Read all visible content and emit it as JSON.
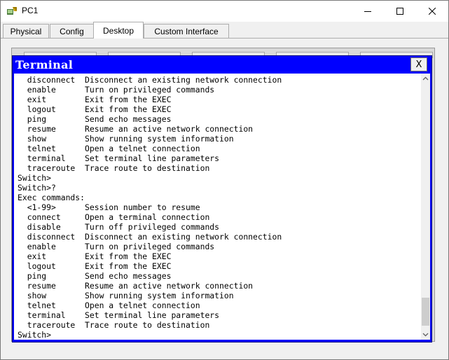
{
  "window": {
    "title": "PC1"
  },
  "tabs": [
    {
      "label": "Physical"
    },
    {
      "label": "Config"
    },
    {
      "label": "Desktop"
    },
    {
      "label": "Custom Interface"
    }
  ],
  "active_tab": "Desktop",
  "terminal": {
    "title": "Terminal",
    "close_label": "X",
    "lines": [
      "  disconnect  Disconnect an existing network connection",
      "  enable      Turn on privileged commands",
      "  exit        Exit from the EXEC",
      "  logout      Exit from the EXEC",
      "  ping        Send echo messages",
      "  resume      Resume an active network connection",
      "  show        Show running system information",
      "  telnet      Open a telnet connection",
      "  terminal    Set terminal line parameters",
      "  traceroute  Trace route to destination",
      "Switch>",
      "Switch>?",
      "Exec commands:",
      "  <1-99>      Session number to resume",
      "  connect     Open a terminal connection",
      "  disable     Turn off privileged commands",
      "  disconnect  Disconnect an existing network connection",
      "  enable      Turn on privileged commands",
      "  exit        Exit from the EXEC",
      "  logout      Exit from the EXEC",
      "  ping        Send echo messages",
      "  resume      Resume an active network connection",
      "  show        Show running system information",
      "  telnet      Open a telnet connection",
      "  terminal    Set terminal line parameters",
      "  traceroute  Trace route to destination",
      "Switch>"
    ]
  },
  "colors": {
    "terminal_title_bar": "#0000ff",
    "terminal_background": "#ffffff",
    "terminal_text": "#000000"
  }
}
